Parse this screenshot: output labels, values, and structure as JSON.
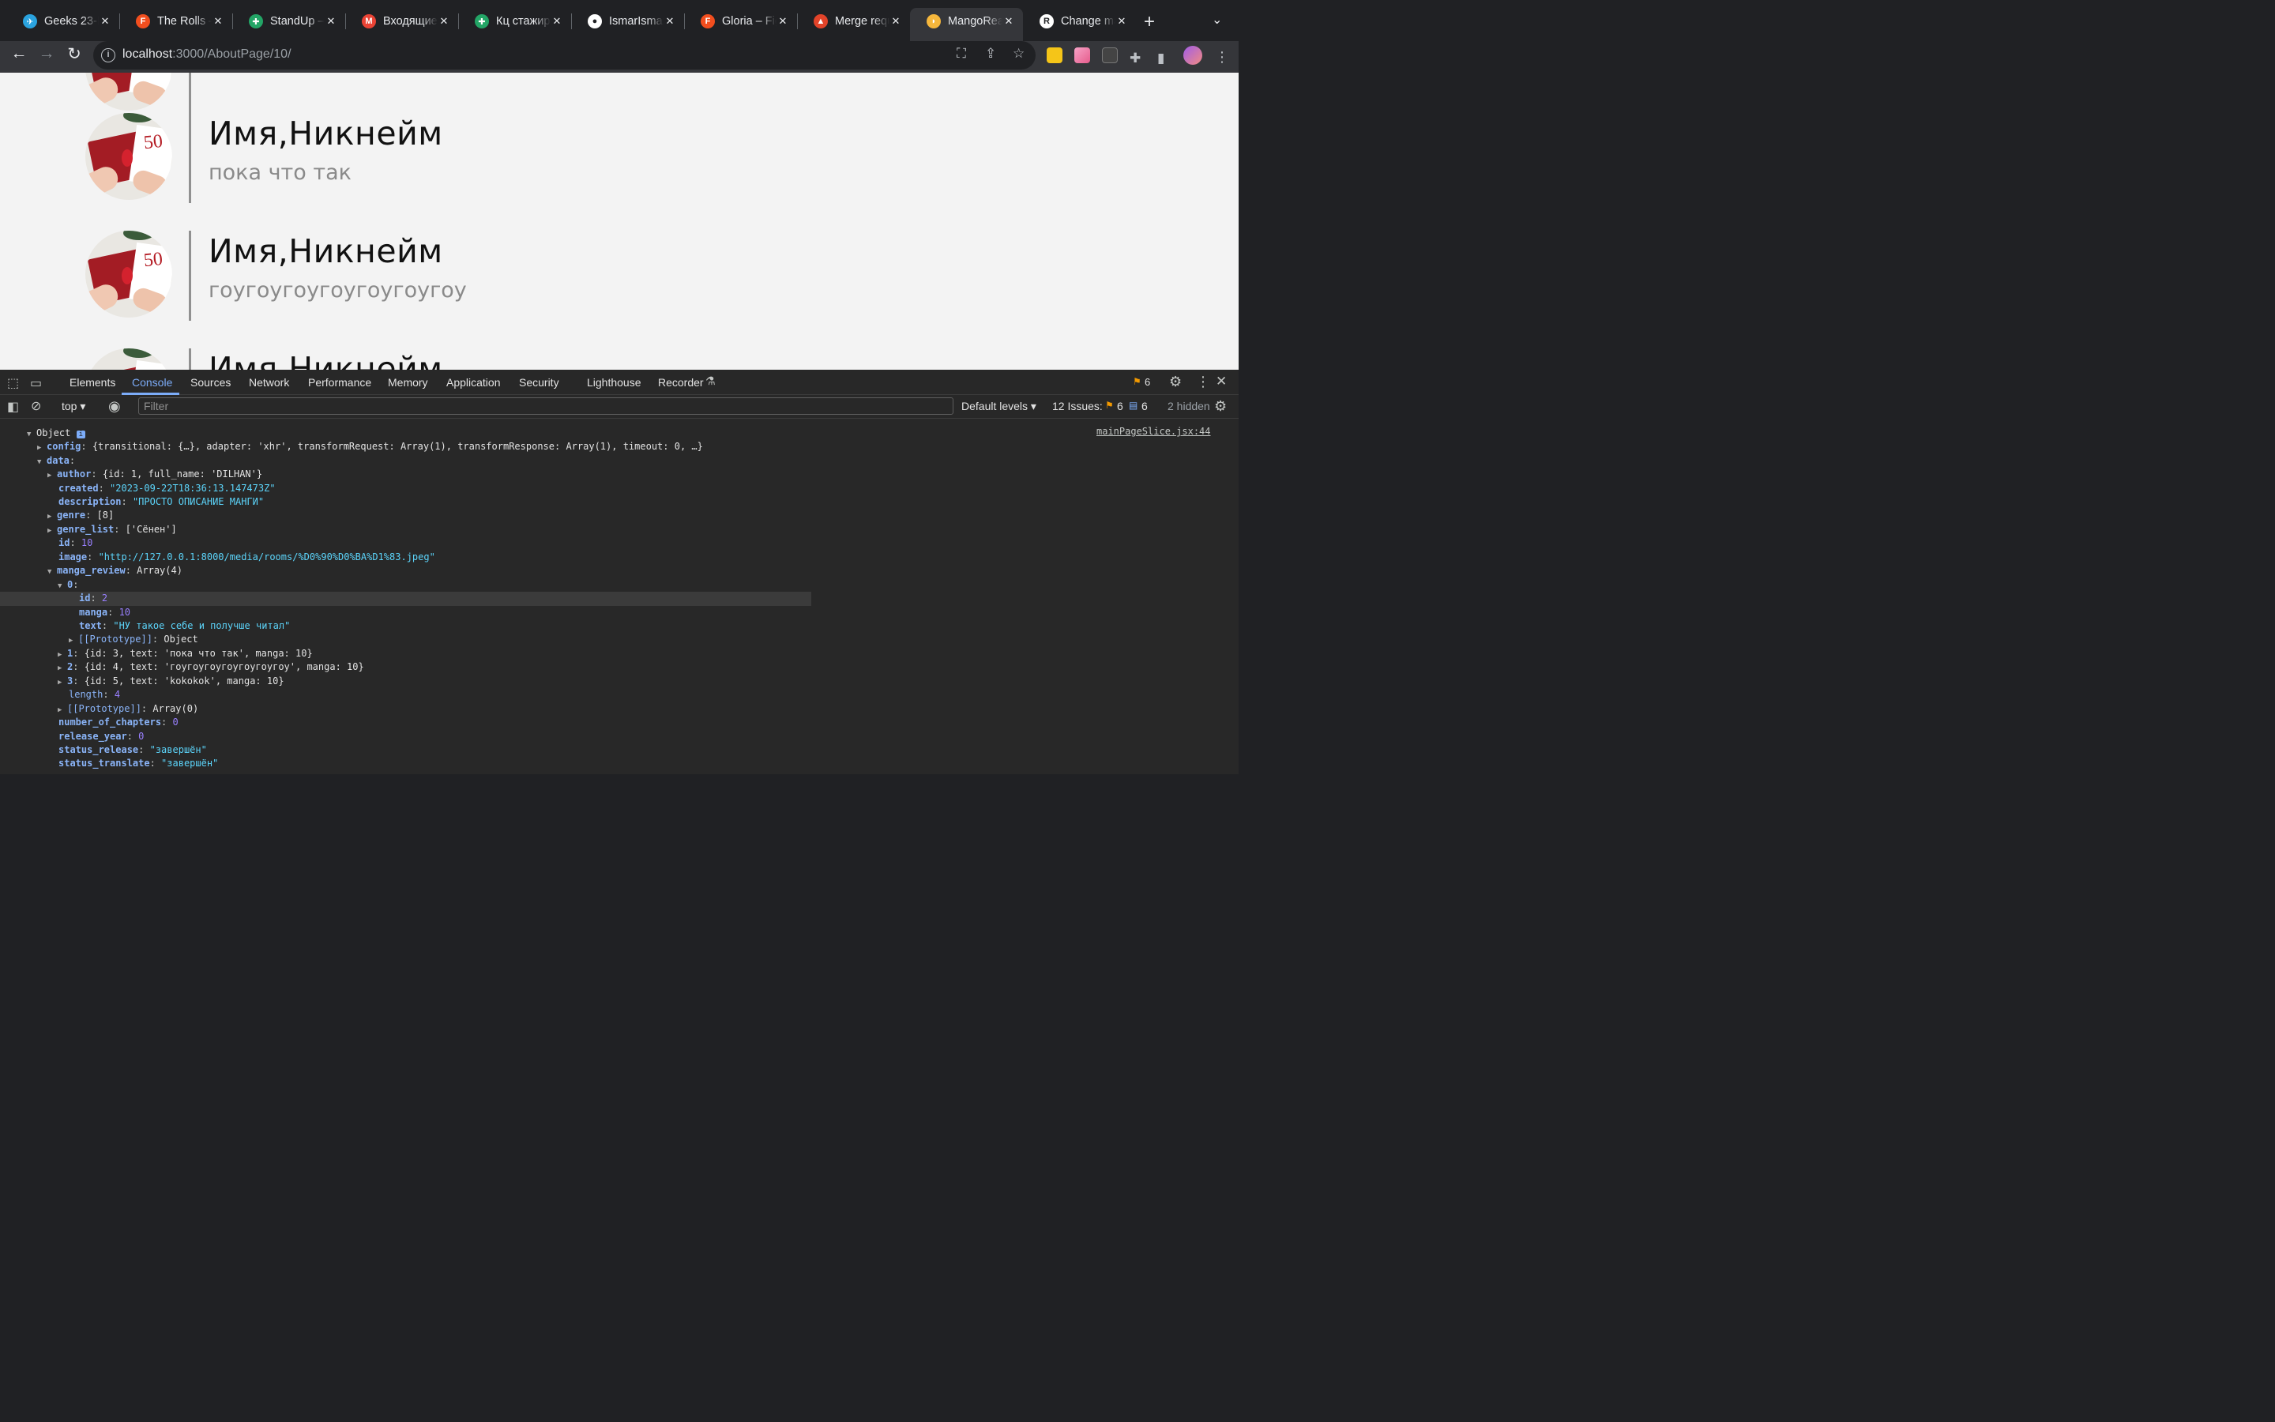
{
  "browser": {
    "tabs": [
      {
        "title": "Geeks 23-Б",
        "icon": "telegram-icon",
        "color": "#2aa3df"
      },
      {
        "title": "The Rolls –",
        "icon": "figma-icon",
        "color": "#f24e1e"
      },
      {
        "title": "StandUp –",
        "icon": "sheets-icon",
        "color": "#23a566"
      },
      {
        "title": "Входящие",
        "icon": "gmail-icon",
        "color": "#ea4335"
      },
      {
        "title": "Кц стажир",
        "icon": "sheets-icon",
        "color": "#23a566"
      },
      {
        "title": "IsmarIsmaz",
        "icon": "github-icon",
        "color": "#ffffff"
      },
      {
        "title": "Gloria – Fig",
        "icon": "figma-icon",
        "color": "#f24e1e"
      },
      {
        "title": "Merge requ",
        "icon": "gitlab-icon",
        "color": "#e24329"
      },
      {
        "title": "MangoRea",
        "icon": "mango-icon",
        "color": "#f6b73c"
      },
      {
        "title": "Change ma",
        "icon": "app-icon",
        "color": "#ffffff"
      }
    ],
    "new_tab": "+",
    "url_host": "localhost",
    "url_path": ":3000/AboutPage/10/"
  },
  "page": {
    "reviews": [
      {
        "name": "Имя,Никнейм",
        "text": "пока что так"
      },
      {
        "name": "Имя,Никнейм",
        "text": "гоугоугоугоугоугоугоу"
      },
      {
        "name": "Имя,Никнейм",
        "text": ""
      }
    ]
  },
  "devtools": {
    "tabs": [
      "Elements",
      "Console",
      "Sources",
      "Network",
      "Performance",
      "Memory",
      "Application",
      "Security",
      "Lighthouse",
      "Recorder"
    ],
    "active_tab": "Console",
    "warnings_count": "6",
    "context": "top",
    "filter_placeholder": "Filter",
    "levels": "Default levels",
    "issues_label": "12 Issues:",
    "issues_warn": "6",
    "issues_info": "6",
    "hidden": "2 hidden",
    "source_link": "mainPageSlice.jsx:44"
  },
  "console": {
    "object_label": "Object",
    "config_line": "{transitional: {…}, adapter: 'xhr', transformRequest: Array(1), transformResponse: Array(1), timeout: 0, …}",
    "author": "{id: 1, full_name: 'DILHAN'}",
    "created": "\"2023-09-22T18:36:13.147473Z\"",
    "description": "\"ПРОСТО ОПИСАНИЕ МАНГИ\"",
    "genre": "[8]",
    "genre_list": "['Сёнен']",
    "id": "10",
    "image": "\"http://127.0.0.1:8000/media/rooms/%D0%90%D0%BA%D1%83.jpeg\"",
    "manga_review": "Array(4)",
    "review0_id": "2",
    "review0_manga": "10",
    "review0_text": "\"НУ такое себе и получше читал\"",
    "review0_proto": "Object",
    "review1": "{id: 3, text: 'пока что так', manga: 10}",
    "review2": "{id: 4, text: 'гоугоугоугоугоугоугоу', manga: 10}",
    "review3": "{id: 5, text: 'kokokok', manga: 10}",
    "length": "4",
    "array_proto": "Array(0)",
    "number_of_chapters": "0",
    "release_year": "0",
    "status_release": "\"завершён\"",
    "status_translate": "\"завершён\""
  }
}
